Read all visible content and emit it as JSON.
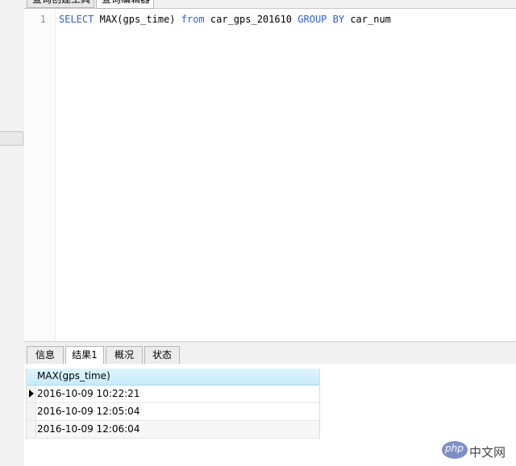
{
  "top_tabs": [
    {
      "label": "查询创建工具"
    },
    {
      "label": "查询编辑器"
    }
  ],
  "editor": {
    "line_number": "1",
    "tokens": {
      "select": "SELECT",
      "func": "MAX(gps_time)",
      "from": "from",
      "table": "car_gps_201610",
      "group": "GROUP",
      "by": "BY",
      "column": "car_num"
    }
  },
  "result_tabs": [
    {
      "label": "信息"
    },
    {
      "label": "结果1"
    },
    {
      "label": "概况"
    },
    {
      "label": "状态"
    }
  ],
  "result": {
    "column": "MAX(gps_time)",
    "rows": [
      "2016-10-09 10:22:21",
      "2016-10-09 12:05:04",
      "2016-10-09 12:06:04"
    ]
  },
  "watermark": {
    "logo_text": "php",
    "site_text": "中文网"
  },
  "colors": {
    "keyword": "#3060d0",
    "header_bg": "#c7ebfb"
  }
}
